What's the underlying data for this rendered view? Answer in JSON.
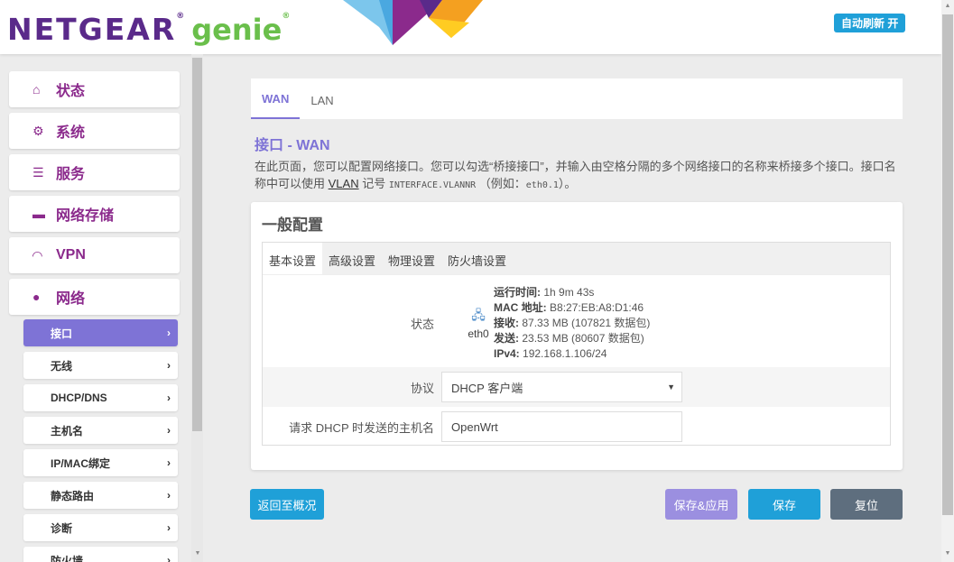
{
  "header": {
    "logo_main": "NETGEAR",
    "logo_sub": "genie",
    "auto_refresh": "自动刷新 开"
  },
  "sidebar": {
    "menus": [
      {
        "icon": "home-icon",
        "label": "状态"
      },
      {
        "icon": "gears-icon",
        "label": "系统"
      },
      {
        "icon": "list-icon",
        "label": "服务"
      },
      {
        "icon": "drive-icon",
        "label": "网络存储"
      },
      {
        "icon": "gauge-icon",
        "label": "VPN"
      },
      {
        "icon": "globe-icon",
        "label": "网络"
      }
    ],
    "submenus": [
      {
        "label": "接口",
        "active": true
      },
      {
        "label": "无线"
      },
      {
        "label": "DHCP/DNS"
      },
      {
        "label": "主机名"
      },
      {
        "label": "IP/MAC绑定"
      },
      {
        "label": "静态路由"
      },
      {
        "label": "诊断"
      },
      {
        "label": "防火墙"
      }
    ]
  },
  "tabs": [
    "WAN",
    "LAN"
  ],
  "page": {
    "title": "接口 - WAN",
    "desc_1": "在此页面，您可以配置网络接口。您可以勾选“桥接接口”，并输入由空格分隔的多个网络接口的名称来桥接多个接口。接口名称中可以使用 ",
    "desc_vlan": "VLAN",
    "desc_2": " 记号 ",
    "desc_code": "INTERFACE.VLANNR",
    "desc_3": " （例如：",
    "desc_code2": "eth0.1",
    "desc_4": "）。"
  },
  "section": {
    "title": "一般配置",
    "tabs": [
      "基本设置",
      "高级设置",
      "物理设置",
      "防火墙设置"
    ],
    "status": {
      "label": "状态",
      "iface": "eth0",
      "uptime_k": "运行时间:",
      "uptime": "1h 9m 43s",
      "mac_k": "MAC 地址:",
      "mac": "B8:27:EB:A8:D1:46",
      "rx_k": "接收:",
      "rx": "87.33 MB (107821 数据包)",
      "tx_k": "发送:",
      "tx": "23.53 MB (80607 数据包)",
      "ip_k": "IPv4:",
      "ip": "192.168.1.106/24"
    },
    "protocol": {
      "label": "协议",
      "value": "DHCP 客户端"
    },
    "hostname": {
      "label": "请求 DHCP 时发送的主机名",
      "value": "OpenWrt"
    }
  },
  "buttons": {
    "back": "返回至概况",
    "save_apply": "保存&应用",
    "save": "保存",
    "reset": "复位"
  }
}
